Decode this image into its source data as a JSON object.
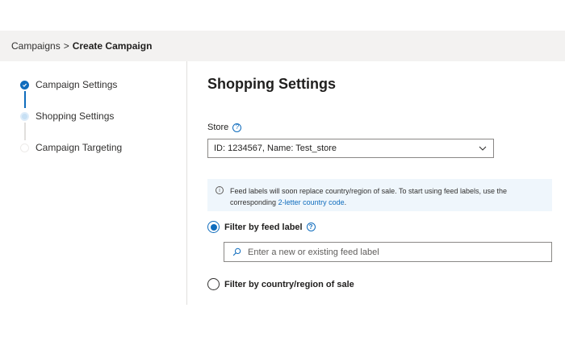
{
  "breadcrumb": {
    "parent": "Campaigns",
    "separator": ">",
    "current": "Create Campaign"
  },
  "steps": [
    {
      "label": "Campaign Settings",
      "state": "done"
    },
    {
      "label": "Shopping Settings",
      "state": "active"
    },
    {
      "label": "Campaign Targeting",
      "state": "pending"
    }
  ],
  "main": {
    "title": "Shopping Settings",
    "store": {
      "label": "Store",
      "help_icon": "?",
      "selected": "ID: 1234567, Name: Test_store"
    },
    "info": {
      "icon": "i",
      "text": "Feed labels will soon replace country/region of sale. To start using feed labels, use the corresponding",
      "link": "2-letter country code",
      "suffix": "."
    },
    "filter_feed": {
      "label": "Filter by feed label",
      "help_icon": "?",
      "checked": true,
      "placeholder": "Enter a new or existing feed label"
    },
    "filter_country": {
      "label": "Filter by country/region of sale",
      "checked": false
    }
  },
  "colors": {
    "accent": "#0f6cbd",
    "info_bg": "#eff6fc",
    "topbar_bg": "#f3f2f1"
  }
}
